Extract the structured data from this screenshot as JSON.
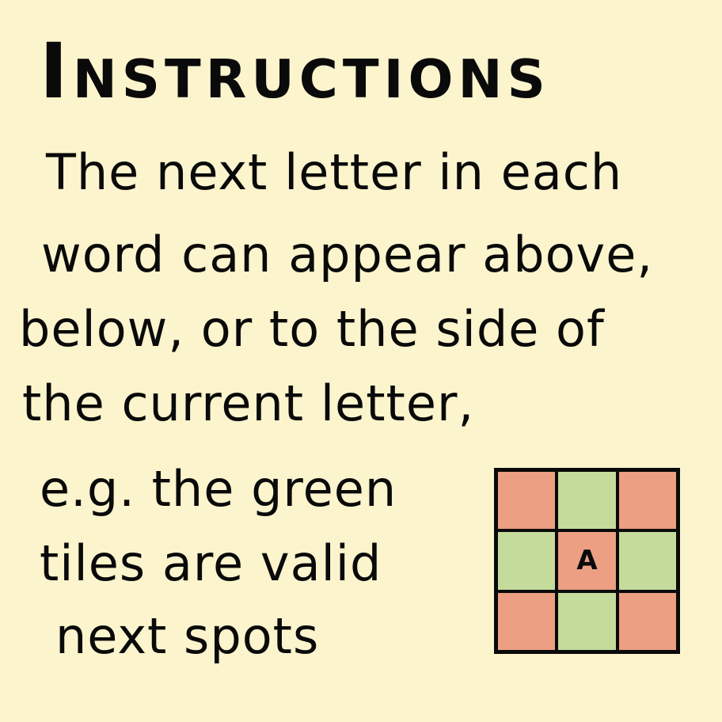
{
  "title": "Instructions",
  "lines": [
    "The next letter in each",
    "word can appear above,",
    "below, or to the side of",
    "the current letter,",
    "e.g. the green",
    "tiles are valid",
    "next spots"
  ],
  "grid": {
    "colors": {
      "red": "#ec9f82",
      "green": "#c5db9c"
    },
    "cells": [
      {
        "state": "red",
        "label": ""
      },
      {
        "state": "green",
        "label": ""
      },
      {
        "state": "red",
        "label": ""
      },
      {
        "state": "green",
        "label": ""
      },
      {
        "state": "red",
        "label": "A"
      },
      {
        "state": "green",
        "label": ""
      },
      {
        "state": "red",
        "label": ""
      },
      {
        "state": "green",
        "label": ""
      },
      {
        "state": "red",
        "label": ""
      }
    ]
  }
}
